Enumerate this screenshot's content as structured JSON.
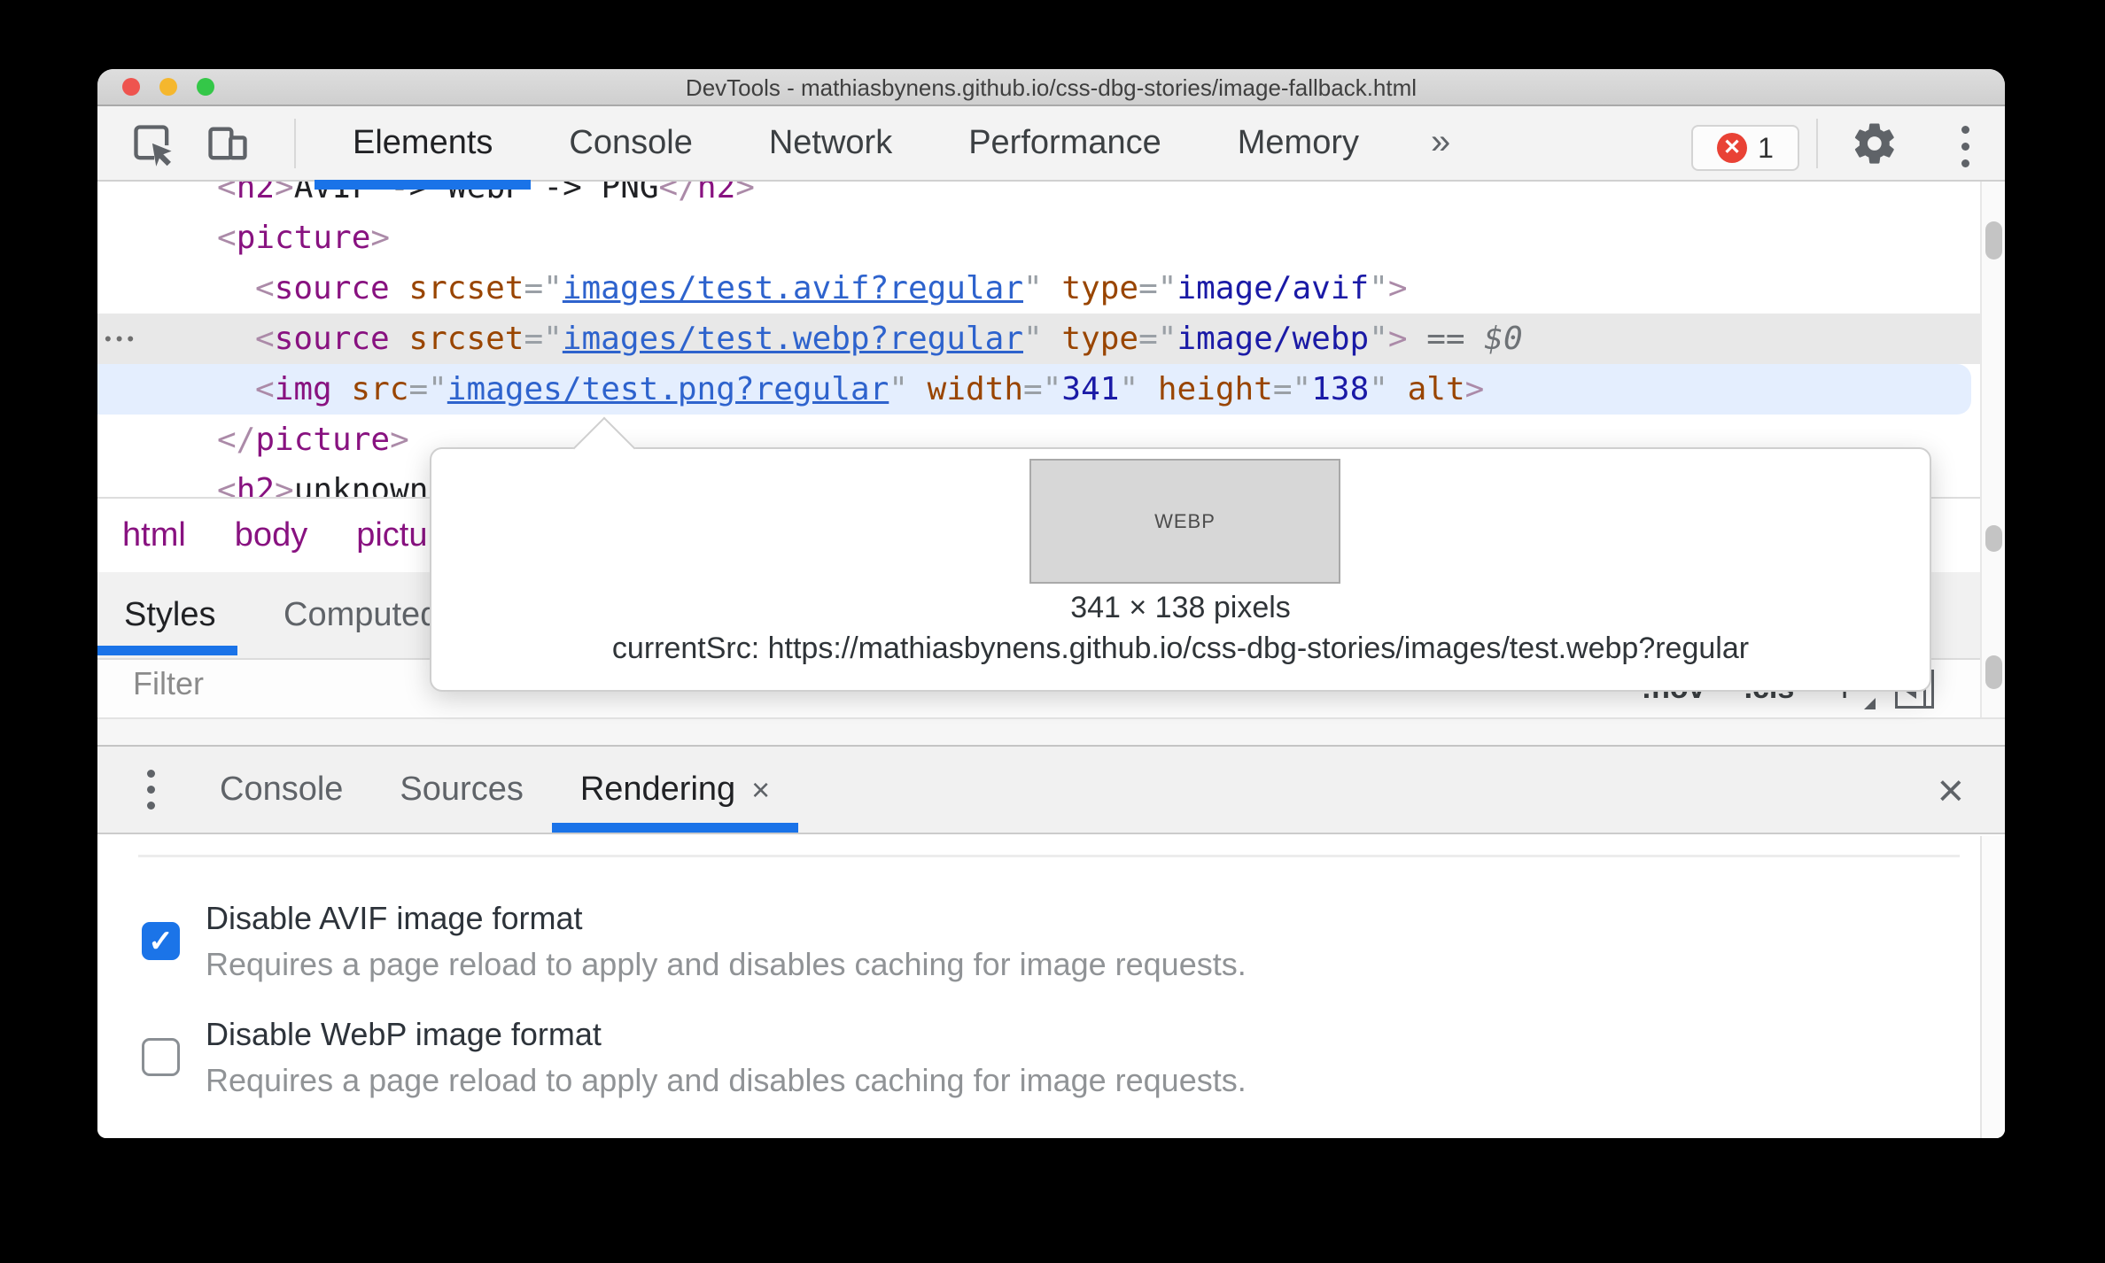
{
  "window": {
    "title": "DevTools - mathiasbynens.github.io/css-dbg-stories/image-fallback.html"
  },
  "toolbar": {
    "tabs": [
      {
        "label": "Elements",
        "active": true
      },
      {
        "label": "Console",
        "active": false
      },
      {
        "label": "Network",
        "active": false
      },
      {
        "label": "Performance",
        "active": false
      },
      {
        "label": "Memory",
        "active": false
      }
    ],
    "more_tabs_glyph": "»",
    "error_count": "1"
  },
  "elements_panel": {
    "code_lines": [
      {
        "tokens": [
          [
            "b",
            "<"
          ],
          [
            "t",
            "h2"
          ],
          [
            "b",
            ">"
          ],
          [
            "x",
            "AVIF -> WebP -> PNG"
          ],
          [
            "b",
            "</"
          ],
          [
            "t",
            "h2"
          ],
          [
            "b",
            ">"
          ]
        ]
      },
      {
        "tokens": [
          [
            "b",
            "<"
          ],
          [
            "t",
            "picture"
          ],
          [
            "b",
            ">"
          ]
        ]
      },
      {
        "tokens": [
          [
            "b",
            "<"
          ],
          [
            "t",
            "source"
          ],
          [
            "x",
            " "
          ],
          [
            "a",
            "srcset"
          ],
          [
            "p",
            "=\""
          ],
          [
            "l",
            "images/test.avif?regular"
          ],
          [
            "p",
            "\""
          ],
          [
            "x",
            " "
          ],
          [
            "a",
            "type"
          ],
          [
            "p",
            "=\""
          ],
          [
            "v",
            "image/avif"
          ],
          [
            "p",
            "\""
          ],
          [
            "b",
            ">"
          ]
        ]
      },
      {
        "tokens": [
          [
            "b",
            "<"
          ],
          [
            "t",
            "source"
          ],
          [
            "x",
            " "
          ],
          [
            "a",
            "srcset"
          ],
          [
            "p",
            "=\""
          ],
          [
            "l",
            "images/test.webp?regular"
          ],
          [
            "p",
            "\""
          ],
          [
            "x",
            " "
          ],
          [
            "a",
            "type"
          ],
          [
            "p",
            "=\""
          ],
          [
            "v",
            "image/webp"
          ],
          [
            "p",
            "\""
          ],
          [
            "b",
            ">"
          ],
          [
            "x",
            "  "
          ],
          [
            "m",
            "=="
          ],
          [
            "x",
            " "
          ],
          [
            "d",
            "$0"
          ]
        ]
      },
      {
        "tokens": [
          [
            "b",
            "<"
          ],
          [
            "t",
            "img"
          ],
          [
            "x",
            " "
          ],
          [
            "a",
            "src"
          ],
          [
            "p",
            "=\""
          ],
          [
            "l",
            "images/test.png?regular"
          ],
          [
            "p",
            "\""
          ],
          [
            "x",
            " "
          ],
          [
            "a",
            "width"
          ],
          [
            "p",
            "=\""
          ],
          [
            "v",
            "341"
          ],
          [
            "p",
            "\""
          ],
          [
            "x",
            " "
          ],
          [
            "a",
            "height"
          ],
          [
            "p",
            "=\""
          ],
          [
            "v",
            "138"
          ],
          [
            "p",
            "\""
          ],
          [
            "x",
            " "
          ],
          [
            "a",
            "alt"
          ],
          [
            "b",
            ">"
          ]
        ]
      },
      {
        "tokens": [
          [
            "b",
            "</"
          ],
          [
            "t",
            "picture"
          ],
          [
            "b",
            ">"
          ]
        ]
      },
      {
        "tokens": [
          [
            "b",
            "<"
          ],
          [
            "t",
            "h2"
          ],
          [
            "b",
            ">"
          ],
          [
            "x",
            "unknown"
          ]
        ]
      }
    ],
    "hover_gutter_glyph": "•••",
    "breadcrumbs": [
      "html",
      "body",
      "picture"
    ],
    "sidebar_tabs": [
      {
        "label": "Styles",
        "active": true
      },
      {
        "label": "Computed",
        "active": false
      }
    ],
    "filter_placeholder": "Filter",
    "pseudo_state_button": ":hov",
    "class_button": ".cls",
    "new_rule_button": "+"
  },
  "tooltip": {
    "preview_label": "WEBP",
    "dimensions": "341 × 138 pixels",
    "current_src": "currentSrc: https://mathiasbynens.github.io/css-dbg-stories/images/test.webp?regular"
  },
  "drawer": {
    "tabs": [
      {
        "label": "Console",
        "active": false
      },
      {
        "label": "Sources",
        "active": false
      },
      {
        "label": "Rendering",
        "active": true,
        "closable": true
      }
    ],
    "close_glyph": "×",
    "options": [
      {
        "label": "Disable AVIF image format",
        "description": "Requires a page reload to apply and disables caching for image requests.",
        "checked": true
      },
      {
        "label": "Disable WebP image format",
        "description": "Requires a page reload to apply and disables caching for image requests.",
        "checked": false
      }
    ]
  },
  "icons": {
    "check_glyph": "✓",
    "error_glyph": "✕"
  },
  "colors": {
    "accent": "#1a73e8",
    "error": "#e94235",
    "tag": "#881280",
    "attribute": "#994500",
    "value": "#1a1aa6",
    "link": "#2e63cd",
    "selected_line": "#e4eefe",
    "hover_line": "#e8e8e8"
  }
}
